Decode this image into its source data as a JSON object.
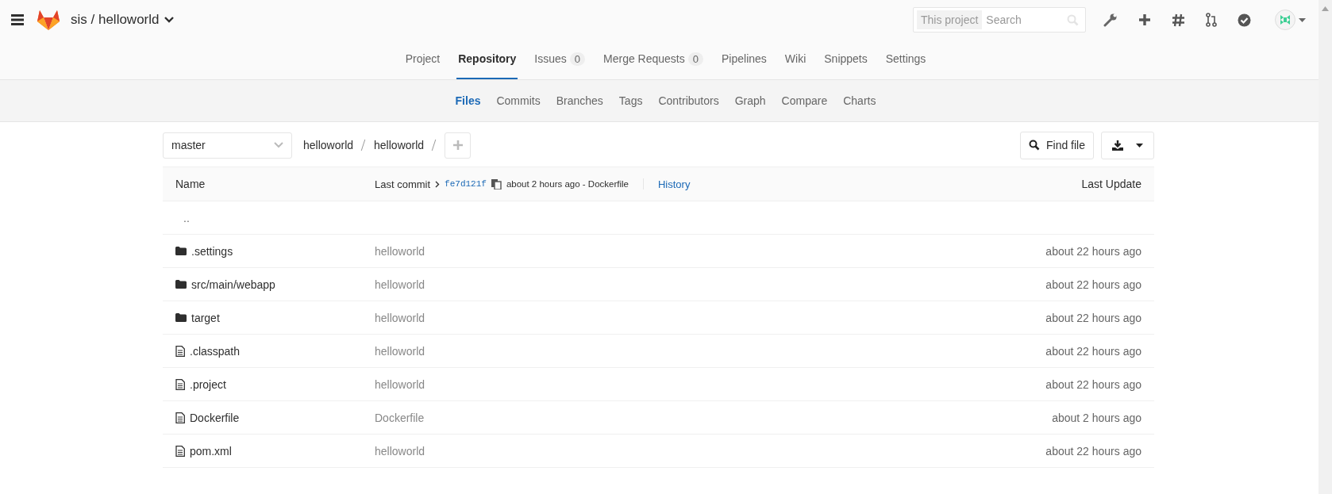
{
  "header": {
    "project_path": "sis / helloworld",
    "search": {
      "scope": "This project",
      "placeholder": "Search"
    }
  },
  "project_nav": [
    {
      "label": "Project",
      "selected": false
    },
    {
      "label": "Repository",
      "selected": true
    },
    {
      "label": "Issues",
      "count": "0",
      "selected": false
    },
    {
      "label": "Merge Requests",
      "count": "0",
      "selected": false
    },
    {
      "label": "Pipelines",
      "selected": false
    },
    {
      "label": "Wiki",
      "selected": false
    },
    {
      "label": "Snippets",
      "selected": false
    },
    {
      "label": "Settings",
      "selected": false
    }
  ],
  "sub_nav": [
    {
      "label": "Files",
      "selected": true
    },
    {
      "label": "Commits",
      "selected": false
    },
    {
      "label": "Branches",
      "selected": false
    },
    {
      "label": "Tags",
      "selected": false
    },
    {
      "label": "Contributors",
      "selected": false
    },
    {
      "label": "Graph",
      "selected": false
    },
    {
      "label": "Compare",
      "selected": false
    },
    {
      "label": "Charts",
      "selected": false
    }
  ],
  "branch": "master",
  "breadcrumb": [
    "helloworld",
    "helloworld"
  ],
  "find_file": "Find file",
  "table": {
    "columns": [
      "Name",
      "Last Update"
    ],
    "last_commit": {
      "label": "Last commit",
      "sha": "fe7d121f",
      "message": "about 2 hours ago - Dockerfile",
      "history": "History"
    },
    "rows": [
      {
        "kind": "parent",
        "name": ".."
      },
      {
        "kind": "folder",
        "name": ".settings",
        "commit": "helloworld",
        "updated": "about 22 hours ago"
      },
      {
        "kind": "folder",
        "name": "src/main/webapp",
        "commit": "helloworld",
        "updated": "about 22 hours ago"
      },
      {
        "kind": "folder",
        "name": "target",
        "commit": "helloworld",
        "updated": "about 22 hours ago"
      },
      {
        "kind": "file",
        "name": ".classpath",
        "commit": "helloworld",
        "updated": "about 22 hours ago"
      },
      {
        "kind": "file",
        "name": ".project",
        "commit": "helloworld",
        "updated": "about 22 hours ago"
      },
      {
        "kind": "file",
        "name": "Dockerfile",
        "commit": "Dockerfile",
        "updated": "about 2 hours ago"
      },
      {
        "kind": "file",
        "name": "pom.xml",
        "commit": "helloworld",
        "updated": "about 22 hours ago"
      }
    ]
  }
}
